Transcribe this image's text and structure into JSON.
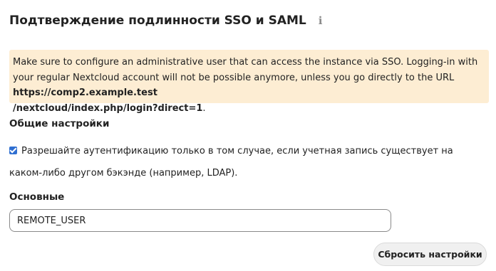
{
  "header": {
    "title": "Подтверждение подлинности SSO и SAML",
    "info_icon": "ℹ"
  },
  "warning": {
    "text_before_url": "Make sure to configure an administrative user that can access the instance via SSO. Logging-in with your regular Nextcloud account will not be possible anymore, unless you go directly to the URL ",
    "url_part1": "https://comp2.example.test",
    "url_part2": "/nextcloud/index.php/login?direct=1",
    "text_after_url": ".",
    "background_color": "#fdedd3"
  },
  "general_settings": {
    "heading": "Общие настройки",
    "checkbox_checked": true,
    "checkbox_label": "Разрешайте аутентификацию только в том случае, если учетная запись существует на каком-либо другом бэкэнде (например, LDAP)."
  },
  "basic": {
    "heading": "Основные",
    "input_value": "REMOTE_USER"
  },
  "actions": {
    "reset_label": "Сбросить настройки"
  },
  "colors": {
    "accent": "#2f6fd1"
  }
}
